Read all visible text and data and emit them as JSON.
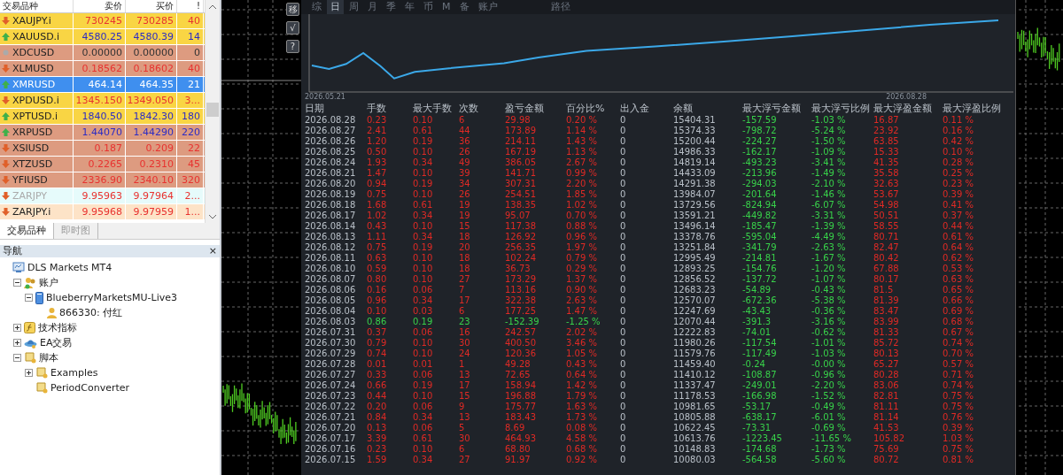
{
  "market_watch": {
    "columns": [
      "交易品种",
      "卖价",
      "买价",
      "!"
    ],
    "rows": [
      {
        "symbol": "XAUJPY.i",
        "bid": "730245",
        "ask": "730285",
        "spread": "40",
        "kind": "down",
        "color": "#f9d544",
        "selected": false,
        "disabled": false
      },
      {
        "symbol": "XAUUSD.i",
        "bid": "4580.25",
        "ask": "4580.39",
        "spread": "14",
        "kind": "up",
        "color": "#f9d544",
        "selected": false,
        "disabled": false
      },
      {
        "symbol": "XDCUSD",
        "bid": "0.00000",
        "ask": "0.00000",
        "spread": "0",
        "kind": "flat",
        "color": "#dd9b80",
        "selected": false,
        "disabled": false
      },
      {
        "symbol": "XLMUSD",
        "bid": "0.18562",
        "ask": "0.18602",
        "spread": "40",
        "kind": "down",
        "color": "#dd9b80",
        "selected": false,
        "disabled": false
      },
      {
        "symbol": "XMRUSD",
        "bid": "464.14",
        "ask": "464.35",
        "spread": "21",
        "kind": "up",
        "color": "#3f8fef",
        "selected": true,
        "disabled": false
      },
      {
        "symbol": "XPDUSD.i",
        "bid": "1345.150",
        "ask": "1349.050",
        "spread": "3...",
        "kind": "down",
        "color": "#f9d544",
        "selected": false,
        "disabled": false
      },
      {
        "symbol": "XPTUSD.i",
        "bid": "1840.50",
        "ask": "1842.30",
        "spread": "180",
        "kind": "up",
        "color": "#f9d544",
        "selected": false,
        "disabled": false
      },
      {
        "symbol": "XRPUSD",
        "bid": "1.44070",
        "ask": "1.44290",
        "spread": "220",
        "kind": "up",
        "color": "#dd9b80",
        "selected": false,
        "disabled": false
      },
      {
        "symbol": "XSIUSD",
        "bid": "0.187",
        "ask": "0.209",
        "spread": "22",
        "kind": "down",
        "color": "#dd9b80",
        "selected": false,
        "disabled": false
      },
      {
        "symbol": "XTZUSD",
        "bid": "0.2265",
        "ask": "0.2310",
        "spread": "45",
        "kind": "down",
        "color": "#dd9b80",
        "selected": false,
        "disabled": false
      },
      {
        "symbol": "YFIUSD",
        "bid": "2336.90",
        "ask": "2340.10",
        "spread": "320",
        "kind": "down",
        "color": "#dd9b80",
        "selected": false,
        "disabled": false
      },
      {
        "symbol": "ZARJPY",
        "bid": "9.95963",
        "ask": "9.97964",
        "spread": "2...",
        "kind": "down",
        "color": "#e6fbfb",
        "selected": false,
        "disabled": true
      },
      {
        "symbol": "ZARJPY.i",
        "bid": "9.95968",
        "ask": "9.97959",
        "spread": "1...",
        "kind": "down",
        "color": "#fde3c7",
        "selected": false,
        "disabled": false
      }
    ]
  },
  "bottom_tabs": [
    {
      "label": "交易品种",
      "selected": true
    },
    {
      "label": "即时图",
      "selected": false
    }
  ],
  "navigator": {
    "title": "导航",
    "close": "×",
    "tree": [
      {
        "label": "DLS Markets MT4",
        "kind": "terminal",
        "children": [
          {
            "label": "账户",
            "kind": "accounts",
            "expanded": true,
            "children": [
              {
                "label": "BlueberryMarketsMU-Live3",
                "kind": "server",
                "expanded": true,
                "children": [
                  {
                    "label": "866330: 付红",
                    "kind": "user"
                  }
                ]
              }
            ]
          },
          {
            "label": "技术指标",
            "kind": "indicators",
            "expanded": false
          },
          {
            "label": "EA交易",
            "kind": "experts",
            "expanded": false
          },
          {
            "label": "脚本",
            "kind": "scripts",
            "expanded": true,
            "children": [
              {
                "label": "Examples",
                "kind": "script",
                "expanded": false
              },
              {
                "label": "PeriodConverter",
                "kind": "script"
              }
            ]
          }
        ]
      }
    ]
  },
  "chart_buttons": [
    "移",
    "√",
    "?"
  ],
  "report": {
    "tabs": [
      {
        "label": "综",
        "selected": false
      },
      {
        "label": "日",
        "selected": true
      },
      {
        "label": "周",
        "selected": false
      },
      {
        "label": "月",
        "selected": false
      },
      {
        "label": "季",
        "selected": false
      },
      {
        "label": "年",
        "selected": false
      },
      {
        "label": "币",
        "selected": false
      },
      {
        "label": "M",
        "selected": false
      },
      {
        "label": "备",
        "selected": false
      },
      {
        "label": "账户",
        "selected": false
      },
      {
        "label": "路径",
        "selected": false
      }
    ],
    "equity_start": "2026.05.21",
    "equity_end": "2026.08.28",
    "columns": [
      "日期",
      "手数",
      "最大手数",
      "次数",
      "盈亏金额",
      "百分比%",
      "出入金",
      "余额",
      "最大浮亏金额",
      "最大浮亏比例",
      "最大浮盈金额",
      "最大浮盈比例"
    ],
    "rows": [
      {
        "loss": false,
        "cells": [
          "2026.08.28",
          "0.23",
          "0.10",
          "6",
          "29.98",
          "0.20 %",
          "0",
          "15404.31",
          "-157.59",
          "-1.03 %",
          "16.87",
          "0.11 %"
        ]
      },
      {
        "loss": false,
        "cells": [
          "2026.08.27",
          "2.41",
          "0.61",
          "44",
          "173.89",
          "1.14 %",
          "0",
          "15374.33",
          "-798.72",
          "-5.24 %",
          "23.92",
          "0.16 %"
        ]
      },
      {
        "loss": false,
        "cells": [
          "2026.08.26",
          "1.20",
          "0.19",
          "36",
          "214.11",
          "1.43 %",
          "0",
          "15200.44",
          "-224.27",
          "-1.50 %",
          "63.85",
          "0.42 %"
        ]
      },
      {
        "loss": false,
        "cells": [
          "2026.08.25",
          "0.50",
          "0.10",
          "26",
          "167.19",
          "1.13 %",
          "0",
          "14986.33",
          "-162.17",
          "-1.09 %",
          "15.33",
          "0.10 %"
        ]
      },
      {
        "loss": false,
        "cells": [
          "2026.08.24",
          "1.93",
          "0.34",
          "49",
          "386.05",
          "2.67 %",
          "0",
          "14819.14",
          "-493.23",
          "-3.41 %",
          "41.35",
          "0.28 %"
        ]
      },
      {
        "loss": false,
        "cells": [
          "2026.08.21",
          "1.47",
          "0.10",
          "39",
          "141.71",
          "0.99 %",
          "0",
          "14433.09",
          "-213.96",
          "-1.49 %",
          "35.58",
          "0.25 %"
        ]
      },
      {
        "loss": false,
        "cells": [
          "2026.08.20",
          "0.94",
          "0.19",
          "34",
          "307.31",
          "2.20 %",
          "0",
          "14291.38",
          "-294.03",
          "-2.10 %",
          "32.63",
          "0.23 %"
        ]
      },
      {
        "loss": false,
        "cells": [
          "2026.08.19",
          "0.75",
          "0.10",
          "26",
          "254.51",
          "1.85 %",
          "0",
          "13984.07",
          "-201.64",
          "-1.46 %",
          "53.67",
          "0.39 %"
        ]
      },
      {
        "loss": false,
        "cells": [
          "2026.08.18",
          "1.68",
          "0.61",
          "19",
          "138.35",
          "1.02 %",
          "0",
          "13729.56",
          "-824.94",
          "-6.07 %",
          "54.98",
          "0.41 %"
        ]
      },
      {
        "loss": false,
        "cells": [
          "2026.08.17",
          "1.02",
          "0.34",
          "19",
          "95.07",
          "0.70 %",
          "0",
          "13591.21",
          "-449.82",
          "-3.31 %",
          "50.51",
          "0.37 %"
        ]
      },
      {
        "loss": false,
        "cells": [
          "2026.08.14",
          "0.43",
          "0.10",
          "15",
          "117.38",
          "0.88 %",
          "0",
          "13496.14",
          "-185.47",
          "-1.39 %",
          "58.55",
          "0.44 %"
        ]
      },
      {
        "loss": false,
        "cells": [
          "2026.08.13",
          "1.11",
          "0.34",
          "18",
          "126.92",
          "0.96 %",
          "0",
          "13378.76",
          "-595.04",
          "-4.49 %",
          "80.71",
          "0.61 %"
        ]
      },
      {
        "loss": false,
        "cells": [
          "2026.08.12",
          "0.75",
          "0.19",
          "20",
          "256.35",
          "1.97 %",
          "0",
          "13251.84",
          "-341.79",
          "-2.63 %",
          "82.47",
          "0.64 %"
        ]
      },
      {
        "loss": false,
        "cells": [
          "2026.08.11",
          "0.63",
          "0.10",
          "18",
          "102.24",
          "0.79 %",
          "0",
          "12995.49",
          "-214.81",
          "-1.67 %",
          "80.42",
          "0.62 %"
        ]
      },
      {
        "loss": false,
        "cells": [
          "2026.08.10",
          "0.59",
          "0.10",
          "18",
          "36.73",
          "0.29 %",
          "0",
          "12893.25",
          "-154.76",
          "-1.20 %",
          "67.88",
          "0.53 %"
        ]
      },
      {
        "loss": false,
        "cells": [
          "2026.08.07",
          "0.80",
          "0.10",
          "27",
          "173.29",
          "1.37 %",
          "0",
          "12856.52",
          "-137.72",
          "-1.07 %",
          "80.17",
          "0.63 %"
        ]
      },
      {
        "loss": false,
        "cells": [
          "2026.08.06",
          "0.16",
          "0.06",
          "7",
          "113.16",
          "0.90 %",
          "0",
          "12683.23",
          "-54.89",
          "-0.43 %",
          "81.5",
          "0.65 %"
        ]
      },
      {
        "loss": false,
        "cells": [
          "2026.08.05",
          "0.96",
          "0.34",
          "17",
          "322.38",
          "2.63 %",
          "0",
          "12570.07",
          "-672.36",
          "-5.38 %",
          "81.39",
          "0.66 %"
        ]
      },
      {
        "loss": false,
        "cells": [
          "2026.08.04",
          "0.10",
          "0.03",
          "6",
          "177.25",
          "1.47 %",
          "0",
          "12247.69",
          "-43.43",
          "-0.36 %",
          "83.47",
          "0.69 %"
        ]
      },
      {
        "loss": true,
        "cells": [
          "2026.08.03",
          "0.86",
          "0.19",
          "23",
          "-152.39",
          "-1.25 %",
          "0",
          "12070.44",
          "-391.3",
          "-3.16 %",
          "83.99",
          "0.68 %"
        ]
      },
      {
        "loss": false,
        "cells": [
          "2026.07.31",
          "0.37",
          "0.06",
          "16",
          "242.57",
          "2.02 %",
          "0",
          "12222.83",
          "-74.01",
          "-0.62 %",
          "81.33",
          "0.67 %"
        ]
      },
      {
        "loss": false,
        "cells": [
          "2026.07.30",
          "0.79",
          "0.10",
          "30",
          "400.50",
          "3.46 %",
          "0",
          "11980.26",
          "-117.54",
          "-1.01 %",
          "85.72",
          "0.74 %"
        ]
      },
      {
        "loss": false,
        "cells": [
          "2026.07.29",
          "0.74",
          "0.10",
          "24",
          "120.36",
          "1.05 %",
          "0",
          "11579.76",
          "-117.49",
          "-1.03 %",
          "80.13",
          "0.70 %"
        ]
      },
      {
        "loss": false,
        "cells": [
          "2026.07.28",
          "0.01",
          "0.01",
          "1",
          "49.28",
          "0.43 %",
          "0",
          "11459.40",
          "-0.24",
          "-0.00 %",
          "65.27",
          "0.57 %"
        ]
      },
      {
        "loss": false,
        "cells": [
          "2026.07.27",
          "0.33",
          "0.06",
          "13",
          "72.65",
          "0.64 %",
          "0",
          "11410.12",
          "-108.87",
          "-0.96 %",
          "80.28",
          "0.71 %"
        ]
      },
      {
        "loss": false,
        "cells": [
          "2026.07.24",
          "0.66",
          "0.19",
          "17",
          "158.94",
          "1.42 %",
          "0",
          "11337.47",
          "-249.01",
          "-2.20 %",
          "83.06",
          "0.74 %"
        ]
      },
      {
        "loss": false,
        "cells": [
          "2026.07.23",
          "0.44",
          "0.10",
          "15",
          "196.88",
          "1.79 %",
          "0",
          "11178.53",
          "-166.98",
          "-1.52 %",
          "82.81",
          "0.75 %"
        ]
      },
      {
        "loss": false,
        "cells": [
          "2026.07.22",
          "0.20",
          "0.06",
          "9",
          "175.77",
          "1.63 %",
          "0",
          "10981.65",
          "-53.17",
          "-0.49 %",
          "81.11",
          "0.75 %"
        ]
      },
      {
        "loss": false,
        "cells": [
          "2026.07.21",
          "0.84",
          "0.34",
          "13",
          "183.43",
          "1.73 %",
          "0",
          "10805.88",
          "-638.17",
          "-6.01 %",
          "81.14",
          "0.76 %"
        ]
      },
      {
        "loss": false,
        "cells": [
          "2026.07.20",
          "0.13",
          "0.06",
          "5",
          "8.69",
          "0.08 %",
          "0",
          "10622.45",
          "-73.31",
          "-0.69 %",
          "41.53",
          "0.39 %"
        ]
      },
      {
        "loss": false,
        "cells": [
          "2026.07.17",
          "3.39",
          "0.61",
          "30",
          "464.93",
          "4.58 %",
          "0",
          "10613.76",
          "-1223.45",
          "-11.65 %",
          "105.82",
          "1.03 %"
        ]
      },
      {
        "loss": false,
        "cells": [
          "2026.07.16",
          "0.23",
          "0.10",
          "6",
          "68.80",
          "0.68 %",
          "0",
          "10148.83",
          "-174.68",
          "-1.73 %",
          "75.69",
          "0.75 %"
        ]
      },
      {
        "loss": false,
        "cells": [
          "2026.07.15",
          "1.59",
          "0.34",
          "27",
          "91.97",
          "0.92 %",
          "0",
          "10080.03",
          "-564.58",
          "-5.60 %",
          "80.72",
          "0.81 %"
        ]
      }
    ]
  }
}
